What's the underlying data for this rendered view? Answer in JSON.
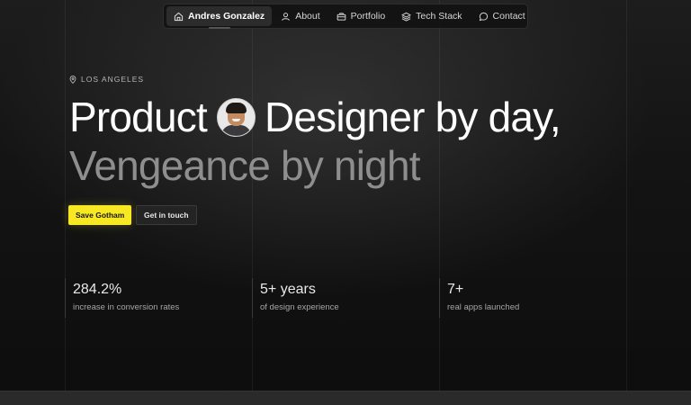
{
  "nav": {
    "items": [
      {
        "label": "Andres Gonzalez",
        "icon": "home-icon",
        "active": true
      },
      {
        "label": "About",
        "icon": "user-icon",
        "active": false
      },
      {
        "label": "Portfolio",
        "icon": "briefcase-icon",
        "active": false
      },
      {
        "label": "Tech Stack",
        "icon": "layers-icon",
        "active": false
      },
      {
        "label": "Contact",
        "icon": "chat-bubble-icon",
        "active": false
      }
    ]
  },
  "hero": {
    "location": "LOS ANGELES",
    "line1_before": "Product",
    "line1_after": "Designer by day,",
    "line2": "Vengeance by night",
    "primary_cta": "Save Gotham",
    "secondary_cta": "Get in touch"
  },
  "stats": [
    {
      "value": "284.2%",
      "label": "increase in conversion rates"
    },
    {
      "value": "5+ years",
      "label": "of design experience"
    },
    {
      "value": "7+",
      "label": "real apps launched"
    }
  ],
  "colors": {
    "accent": "#f7e823",
    "background": "#0b0b0b",
    "headline": "#ffffff",
    "headline_muted": "#8e8e8e"
  }
}
